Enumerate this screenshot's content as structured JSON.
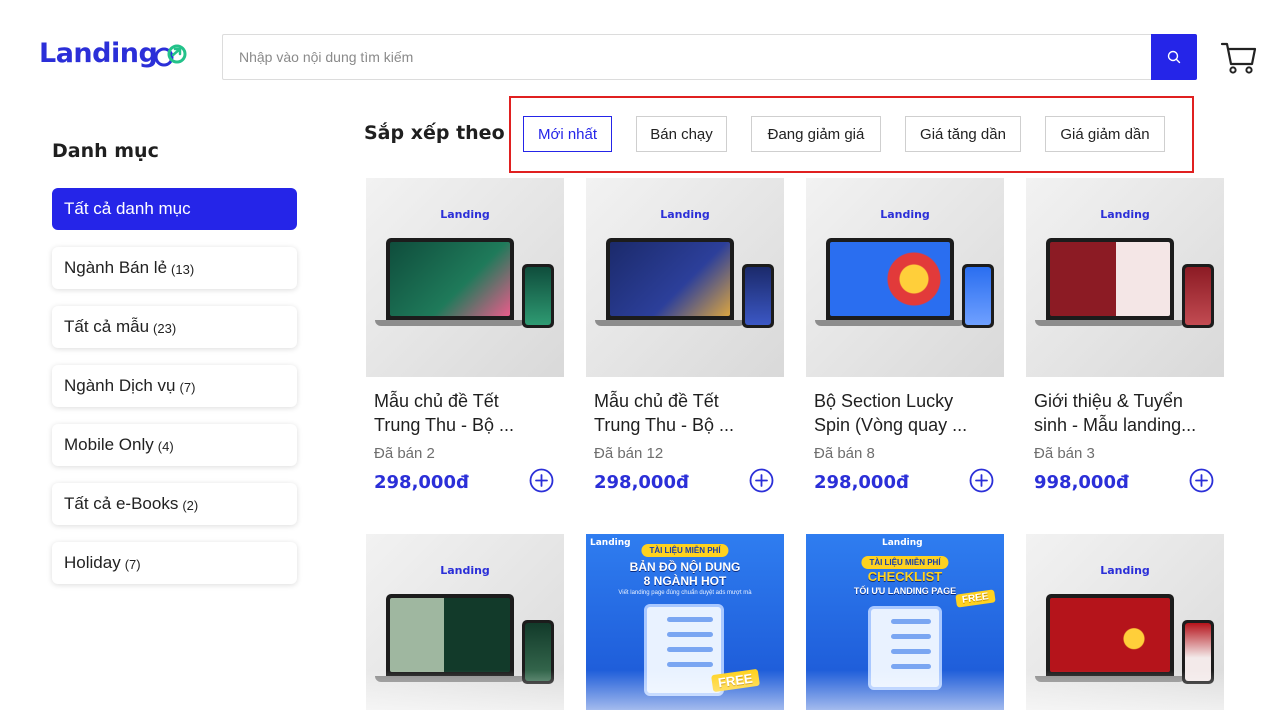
{
  "header": {
    "logo_text": "Landing",
    "search_placeholder": "Nhập vào nội dung tìm kiếm",
    "search_value": "",
    "accent": "#2525e8"
  },
  "sidebar": {
    "title": "Danh mục",
    "items": [
      {
        "label": "Tất cả danh mục",
        "count": "",
        "active": true
      },
      {
        "label": "Ngành Bán lẻ",
        "count": "(13)"
      },
      {
        "label": "Tất cả mẫu",
        "count": "(23)"
      },
      {
        "label": "Ngành Dịch vụ",
        "count": "(7)"
      },
      {
        "label": "Mobile Only",
        "count": "(4)"
      },
      {
        "label": "Tất cả e-Books",
        "count": "(2)"
      },
      {
        "label": "Holiday",
        "count": "(7)"
      }
    ]
  },
  "sort": {
    "label": "Sắp xếp theo",
    "options": [
      "Mới nhất",
      "Bán chạy",
      "Đang giảm giá",
      "Giá tăng dần",
      "Giá giảm dần"
    ],
    "selected": "Mới nhất"
  },
  "products": [
    {
      "title_line1": "Mẫu chủ đề Tết",
      "title_line2": "Trung Thu - Bộ ...",
      "sold": "Đã bán 2",
      "price": "298,000đ",
      "thumb_brand": "Landing",
      "screen_color": "#0f4d3c"
    },
    {
      "title_line1": "Mẫu chủ đề Tết",
      "title_line2": "Trung Thu - Bộ ...",
      "sold": "Đã bán 12",
      "price": "298,000đ",
      "thumb_brand": "Landing",
      "screen_color": "#1b2a6b"
    },
    {
      "title_line1": "Bộ Section Lucky",
      "title_line2": "Spin (Vòng quay ...",
      "sold": "Đã bán 8",
      "price": "298,000đ",
      "thumb_brand": "Landing",
      "screen_color": "#2a6ef0"
    },
    {
      "title_line1": "Giới thiệu & Tuyển",
      "title_line2": "sinh - Mẫu landing...",
      "sold": "Đã bán 3",
      "price": "998,000đ",
      "thumb_brand": "Landing",
      "screen_color": "#8c1b24"
    }
  ],
  "row2": [
    {
      "kind": "device",
      "thumb_brand": "Landing",
      "screen_color": "#123a2a"
    },
    {
      "kind": "banner",
      "brand": "Landing",
      "tag": "TÀI LIỆU MIỄN PHÍ",
      "title_line1": "BẢN ĐỒ NỘI DUNG",
      "title_line2": "8 NGÀNH HOT",
      "sub": "Viết landing page đúng chuẩn duyệt ads mượt mà",
      "badge": "FREE"
    },
    {
      "kind": "banner",
      "brand": "Landing",
      "tag": "TÀI LIỆU MIỄN PHÍ",
      "title_line1": "CHECKLIST",
      "title_line2": "TỐI ƯU LANDING PAGE",
      "sub": "",
      "badge": "FREE"
    },
    {
      "kind": "device",
      "thumb_brand": "Landing",
      "screen_color": "#b5141b"
    }
  ]
}
